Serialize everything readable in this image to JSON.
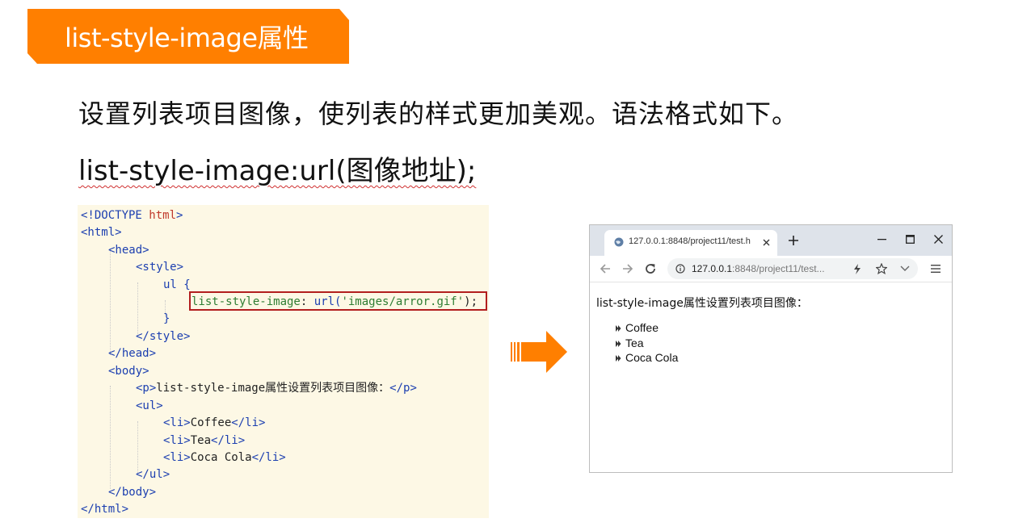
{
  "slide": {
    "title": "list-style-image属性",
    "description": "设置列表项目图像，使列表的样式更加美观。语法格式如下。",
    "syntax": "list-style-image:url(图像地址);"
  },
  "code": {
    "line1_tag": "<!DOCTYPE",
    "line1_kw": "html",
    "line1_end": ">",
    "line2": "<html>",
    "line3": "<head>",
    "line4": "<style>",
    "line5": "ul {",
    "line6_prop": "list-style-image",
    "line6_colon": ": ",
    "line6_url": "url(",
    "line6_str": "'images/arror.gif'",
    "line6_end": ");",
    "line7": "}",
    "line8": "</style>",
    "line9": "</head>",
    "line10": "<body>",
    "line11_open": "<p>",
    "line11_text": "list-style-image属性设置列表项目图像：",
    "line11_close": "</p>",
    "line12": "<ul>",
    "li_open": "<li>",
    "li_close": "</li>",
    "li_items": [
      "Coffee",
      "Tea",
      "Coca Cola"
    ],
    "line16": "</ul>",
    "line17": "</body>",
    "line18": "</html>"
  },
  "browser": {
    "tab_title": "127.0.0.1:8848/project11/test.h",
    "address_host": "127.0.0.1",
    "address_rest": ":8848/project11/test...",
    "page_paragraph": "list-style-image属性设置列表项目图像：",
    "list_items": [
      "Coffee",
      "Tea",
      "Coca Cola"
    ]
  },
  "colors": {
    "accent": "#ff7f00",
    "code_bg": "#fdf8e5",
    "highlight_border": "#b21e1e"
  }
}
